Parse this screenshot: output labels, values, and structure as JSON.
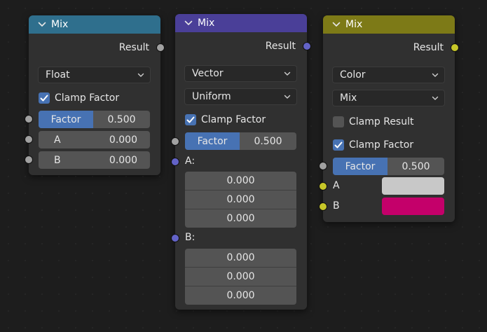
{
  "colors": {
    "float_header": "#2f6f8d",
    "vector_header": "#4a3f98",
    "color_header": "#7d7a17",
    "socket_float": "#a1a1a1",
    "socket_vector": "#6363c7",
    "socket_color": "#c7c729",
    "color_a": "#c8c8c8",
    "color_b": "#c4006a"
  },
  "nodes": {
    "float": {
      "title": "Mix",
      "output": "Result",
      "data_type": "Float",
      "clamp_factor": "Clamp Factor",
      "factor_label": "Factor",
      "factor_value": "0.500",
      "factor_fraction": 0.5,
      "a_label": "A",
      "a_value": "0.000",
      "b_label": "B",
      "b_value": "0.000"
    },
    "vector": {
      "title": "Mix",
      "output": "Result",
      "data_type": "Vector",
      "factor_mode": "Uniform",
      "clamp_factor": "Clamp Factor",
      "factor_label": "Factor",
      "factor_value": "0.500",
      "factor_fraction": 0.5,
      "a_label": "A:",
      "a_values": [
        "0.000",
        "0.000",
        "0.000"
      ],
      "b_label": "B:",
      "b_values": [
        "0.000",
        "0.000",
        "0.000"
      ]
    },
    "color": {
      "title": "Mix",
      "output": "Result",
      "data_type": "Color",
      "blend_mode": "Mix",
      "clamp_result": "Clamp Result",
      "clamp_result_checked": false,
      "clamp_factor": "Clamp Factor",
      "factor_label": "Factor",
      "factor_value": "0.500",
      "factor_fraction": 0.5,
      "a_label": "A",
      "b_label": "B"
    }
  }
}
